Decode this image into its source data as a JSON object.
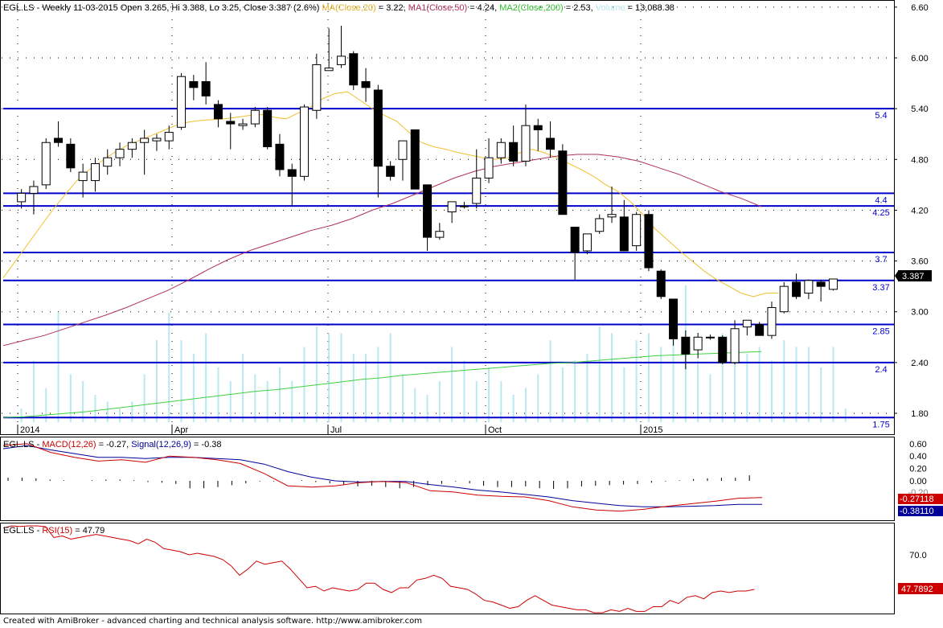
{
  "header": {
    "symbol": "EGL.LS",
    "description": "Weekly 11-03-2015 Open 3.265, Hi 3.388, Lo 3.25, Close 3.387 (2.6%)",
    "ma20_label": "MA(Close,20)",
    "ma20_value": " = 3.22, ",
    "ma50_label": "MA1(Close,50)",
    "ma50_value": " = 4.24, ",
    "ma200_label": "MA2(Close,200)",
    "ma200_value": " = 2.53, ",
    "volume_label": "Volume",
    "volume_value": " = 13,088.38"
  },
  "macd_header": {
    "symbol": "EGL.LS",
    "macd_label": "MACD(12,26)",
    "macd_value": " = -0.27, ",
    "signal_label": "Signal(12,26,9)",
    "signal_value": " = -0.38"
  },
  "rsi_header": {
    "symbol": "EGL.LS",
    "rsi_label": "RSI(15)",
    "rsi_value": " = 47.79"
  },
  "last_price_tag": "3.387",
  "macd_tag": "-0.27118",
  "signal_tag": "-0.38110",
  "rsi_tag": "47.7892",
  "footer": "Created with AmiBroker - advanced charting and technical analysis software. http://www.amibroker.com",
  "colors": {
    "up_candle": "#ffffff",
    "down_candle": "#000000",
    "hline": "#0000cc",
    "ma20": "#f0c030",
    "ma50": "#b03060",
    "ma200": "#40d040",
    "volume": "#b8e8f0",
    "macd": "#cc0000",
    "signal": "#000099",
    "rsi": "#cc0000"
  },
  "chart_data": [
    {
      "type": "candlestick",
      "title": "EGL.LS Weekly",
      "x_tick_labels": [
        "2014",
        "Apr",
        "Jul",
        "Oct",
        "2015"
      ],
      "ylim": [
        1.75,
        6.6
      ],
      "y_ticks": [
        6.6,
        6.0,
        5.4,
        4.8,
        4.2,
        3.6,
        3.0,
        2.4,
        1.8
      ],
      "horizontal_levels": [
        5.4,
        4.4,
        4.25,
        3.7,
        3.37,
        2.85,
        2.4,
        1.75
      ],
      "ohlc": [
        [
          4.3,
          4.45,
          4.22,
          4.4
        ],
        [
          4.4,
          4.55,
          4.15,
          4.48
        ],
        [
          4.5,
          5.05,
          4.45,
          5.0
        ],
        [
          5.05,
          5.25,
          4.95,
          5.0
        ],
        [
          4.98,
          5.05,
          4.65,
          4.7
        ],
        [
          4.55,
          4.75,
          4.35,
          4.65
        ],
        [
          4.55,
          4.82,
          4.42,
          4.75
        ],
        [
          4.72,
          4.92,
          4.62,
          4.82
        ],
        [
          4.82,
          5.0,
          4.72,
          4.92
        ],
        [
          4.92,
          5.05,
          4.82,
          5.0
        ],
        [
          5.0,
          5.15,
          4.62,
          5.05
        ],
        [
          5.02,
          5.1,
          4.9,
          5.05
        ],
        [
          5.02,
          5.2,
          4.92,
          5.12
        ],
        [
          5.18,
          5.82,
          5.15,
          5.78
        ],
        [
          5.72,
          5.8,
          5.5,
          5.65
        ],
        [
          5.72,
          5.95,
          5.45,
          5.55
        ],
        [
          5.45,
          5.5,
          5.18,
          5.28
        ],
        [
          5.25,
          5.35,
          4.92,
          5.22
        ],
        [
          5.2,
          5.28,
          5.15,
          5.22
        ],
        [
          5.22,
          5.42,
          5.18,
          5.38
        ],
        [
          5.38,
          5.42,
          4.92,
          4.95
        ],
        [
          4.98,
          5.1,
          4.6,
          4.68
        ],
        [
          4.68,
          4.75,
          4.25,
          4.6
        ],
        [
          4.6,
          5.45,
          4.55,
          5.42
        ],
        [
          5.38,
          6.05,
          5.28,
          5.92
        ],
        [
          5.85,
          6.35,
          5.85,
          5.88
        ],
        [
          5.92,
          6.38,
          5.88,
          6.02
        ],
        [
          6.05,
          6.08,
          5.62,
          5.68
        ],
        [
          5.72,
          5.88,
          5.48,
          5.65
        ],
        [
          5.62,
          5.68,
          4.35,
          4.72
        ],
        [
          4.72,
          4.78,
          4.55,
          4.6
        ],
        [
          4.8,
          5.0,
          4.55,
          5.02
        ],
        [
          5.15,
          5.15,
          4.45,
          4.45
        ],
        [
          4.5,
          4.5,
          3.72,
          3.88
        ],
        [
          3.88,
          4.05,
          3.85,
          3.95
        ],
        [
          4.18,
          4.3,
          4.05,
          4.3
        ],
        [
          4.25,
          4.3,
          4.22,
          4.25
        ],
        [
          4.28,
          4.92,
          4.22,
          4.58
        ],
        [
          4.58,
          5.05,
          4.52,
          4.82
        ],
        [
          4.82,
          5.05,
          4.75,
          5.0
        ],
        [
          5.0,
          5.2,
          4.72,
          4.78
        ],
        [
          4.78,
          5.45,
          4.72,
          5.2
        ],
        [
          5.2,
          5.28,
          4.9,
          5.15
        ],
        [
          5.05,
          5.25,
          4.82,
          4.92
        ],
        [
          4.9,
          4.98,
          4.2,
          4.15
        ],
        [
          4.0,
          4.0,
          3.38,
          3.7
        ],
        [
          3.72,
          3.92,
          3.68,
          3.92
        ],
        [
          3.95,
          4.15,
          3.92,
          4.1
        ],
        [
          4.12,
          4.48,
          4.05,
          4.15
        ],
        [
          4.12,
          4.32,
          3.72,
          3.72
        ],
        [
          3.78,
          4.18,
          3.72,
          4.15
        ],
        [
          4.15,
          4.2,
          3.48,
          3.52
        ],
        [
          3.48,
          3.5,
          3.15,
          3.18
        ],
        [
          3.15,
          3.15,
          2.6,
          2.68
        ],
        [
          2.7,
          2.78,
          2.32,
          2.5
        ],
        [
          2.55,
          2.75,
          2.45,
          2.7
        ],
        [
          2.7,
          2.73,
          2.67,
          2.7
        ],
        [
          2.7,
          2.72,
          2.38,
          2.4
        ],
        [
          2.4,
          2.9,
          2.38,
          2.8
        ],
        [
          2.82,
          2.9,
          2.72,
          2.9
        ],
        [
          2.85,
          2.88,
          2.72,
          2.72
        ],
        [
          2.72,
          3.12,
          2.68,
          3.05
        ],
        [
          3.0,
          3.35,
          2.98,
          3.3
        ],
        [
          3.35,
          3.45,
          3.15,
          3.18
        ],
        [
          3.22,
          3.38,
          3.15,
          3.37
        ],
        [
          3.35,
          3.38,
          3.12,
          3.3
        ],
        [
          3.265,
          3.388,
          3.25,
          3.387
        ]
      ],
      "ma20": [
        3.4,
        3.6,
        3.8,
        4.0,
        4.2,
        4.38,
        4.55,
        4.68,
        4.78,
        4.88,
        4.96,
        5.02,
        5.08,
        5.14,
        5.2,
        5.24,
        5.26,
        5.27,
        5.28,
        5.3,
        5.32,
        5.33,
        5.3,
        5.28,
        5.35,
        5.42,
        5.52,
        5.58,
        5.6,
        5.5,
        5.4,
        5.32,
        5.25,
        5.12,
        5.0,
        4.95,
        4.92,
        4.88,
        4.85,
        4.82,
        4.8,
        4.82,
        4.88,
        4.92,
        4.88,
        4.82,
        4.75,
        4.68,
        4.6,
        4.5,
        4.42,
        4.3,
        4.15,
        3.98,
        3.85,
        3.72,
        3.6,
        3.48,
        3.38,
        3.3,
        3.22,
        3.18,
        3.22,
        3.22
      ],
      "ma50": [
        2.6,
        2.66,
        2.72,
        2.8,
        2.88,
        2.96,
        3.05,
        3.15,
        3.25,
        3.37,
        3.5,
        3.62,
        3.72,
        3.8,
        3.88,
        3.96,
        4.02,
        4.1,
        4.2,
        4.28,
        4.38,
        4.48,
        4.58,
        4.66,
        4.72,
        4.76,
        4.8,
        4.84,
        4.86,
        4.86,
        4.83,
        4.78,
        4.7,
        4.62,
        4.52,
        4.42,
        4.34,
        4.24
      ],
      "ma200": [
        1.75,
        1.76,
        1.78,
        1.8,
        1.82,
        1.85,
        1.88,
        1.91,
        1.94,
        1.97,
        2.0,
        2.03,
        2.06,
        2.08,
        2.11,
        2.14,
        2.17,
        2.2,
        2.22,
        2.25,
        2.27,
        2.29,
        2.31,
        2.33,
        2.35,
        2.37,
        2.39,
        2.4,
        2.42,
        2.44,
        2.46,
        2.48,
        2.49,
        2.5,
        2.51,
        2.52,
        2.53
      ],
      "volume_rel": [
        0.1,
        0.45,
        0.25,
        0.8,
        0.35,
        0.3,
        0.2,
        0.15,
        0.1,
        0.15,
        0.35,
        0.6,
        0.8,
        0.6,
        0.5,
        0.65,
        0.4,
        0.3,
        0.5,
        0.35,
        0.3,
        0.4,
        0.3,
        0.55,
        0.7,
        0.65,
        0.65,
        0.5,
        0.5,
        0.55,
        0.65,
        0.35,
        0.25,
        0.2,
        0.3,
        0.55,
        0.45,
        0.3,
        0.4,
        0.3,
        0.2,
        0.25,
        0.35,
        0.6,
        0.4,
        0.45,
        0.5,
        0.7,
        0.65,
        0.4,
        0.6,
        0.65,
        0.55,
        0.75,
        1.0,
        0.45,
        0.35,
        0.65,
        0.6,
        0.5,
        0.55,
        0.45,
        0.6,
        0.55,
        0.55,
        0.4,
        0.55,
        0.1
      ],
      "x_labels": [
        "2014",
        "Apr",
        "Jul",
        "Oct",
        "2015"
      ],
      "xlabel": "",
      "ylabel": ""
    },
    {
      "type": "line",
      "title": "MACD(12,26) / Signal(12,26,9)",
      "ylim": [
        -0.5,
        0.6
      ],
      "y_ticks": [
        0.6,
        0.4,
        0.2,
        0.0
      ],
      "series": [
        {
          "name": "MACD(12,26)",
          "values": [
            0.57,
            0.6,
            0.46,
            0.38,
            0.32,
            0.34,
            0.3,
            0.4,
            0.38,
            0.34,
            0.28,
            0.12,
            -0.08,
            -0.1,
            -0.08,
            -0.03,
            -0.01,
            -0.03,
            -0.16,
            -0.18,
            -0.23,
            -0.25,
            -0.26,
            -0.32,
            -0.42,
            -0.47,
            -0.49,
            -0.46,
            -0.41,
            -0.37,
            -0.33,
            -0.28,
            -0.27
          ]
        },
        {
          "name": "Signal(12,26,9)",
          "values": [
            0.52,
            0.57,
            0.5,
            0.44,
            0.38,
            0.38,
            0.36,
            0.38,
            0.38,
            0.36,
            0.34,
            0.27,
            0.15,
            0.06,
            0.0,
            -0.02,
            -0.01,
            -0.01,
            -0.06,
            -0.1,
            -0.15,
            -0.18,
            -0.22,
            -0.26,
            -0.32,
            -0.36,
            -0.4,
            -0.42,
            -0.42,
            -0.41,
            -0.4,
            -0.38,
            -0.38
          ]
        }
      ],
      "histogram": [
        0.05,
        0.05,
        0.04,
        0.02,
        0.01,
        0.0,
        0.01,
        0.02,
        0.02,
        0.01,
        -0.02,
        -0.03,
        -0.05,
        -0.12,
        -0.12,
        -0.1,
        -0.07,
        -0.04,
        -0.01,
        -0.01,
        0.0,
        0.01,
        -0.02,
        -0.04,
        -0.06,
        -0.09,
        -0.08,
        -0.1,
        -0.12,
        -0.1,
        -0.07,
        -0.05,
        -0.01,
        -0.04,
        -0.08,
        -0.1,
        -0.1,
        -0.09,
        -0.12,
        -0.13,
        -0.12,
        -0.09,
        -0.08,
        -0.07,
        -0.06,
        -0.05,
        -0.03,
        -0.01,
        0.01,
        0.03,
        0.04,
        0.05,
        0.05,
        0.09
      ]
    },
    {
      "type": "line",
      "title": "RSI(15)",
      "ylim": [
        30,
        95
      ],
      "y_ticks": [
        70.0
      ],
      "series": [
        {
          "name": "RSI(15)",
          "values": [
            87,
            89,
            88,
            89,
            91,
            88,
            81,
            82,
            80,
            81,
            82,
            83,
            82,
            81,
            80,
            79,
            77,
            80,
            78,
            74,
            73,
            72,
            70,
            71,
            70,
            69,
            67,
            63,
            57,
            61,
            66,
            64,
            65,
            66,
            61,
            55,
            49,
            50,
            47,
            49,
            48,
            47,
            48,
            52,
            52,
            48,
            46,
            49,
            49,
            54,
            55,
            57,
            55,
            50,
            49,
            48,
            45,
            41,
            40,
            38,
            36,
            37,
            41,
            44,
            41,
            38,
            37,
            36,
            35,
            35,
            32,
            33,
            35,
            34,
            36,
            34,
            34,
            37,
            37,
            41,
            39,
            43,
            44,
            42,
            46,
            47,
            46,
            47,
            47,
            48
          ]
        }
      ]
    }
  ]
}
